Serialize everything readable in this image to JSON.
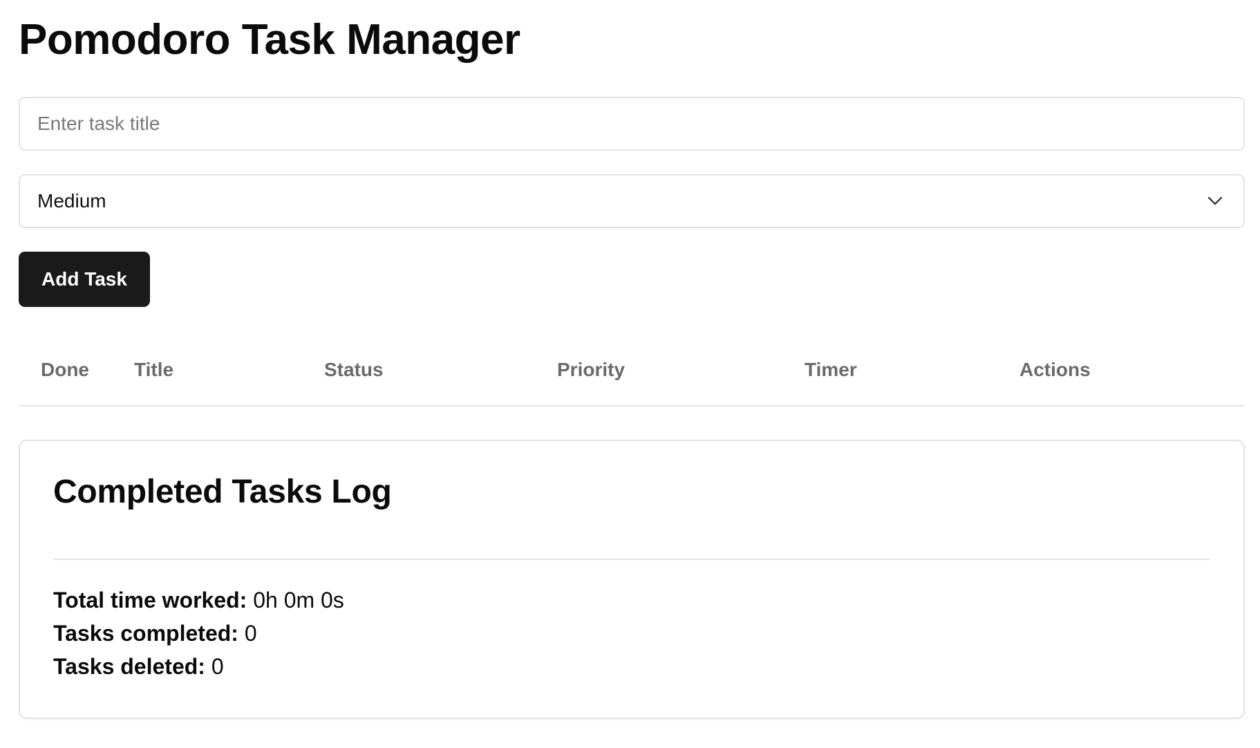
{
  "header": {
    "title": "Pomodoro Task Manager"
  },
  "form": {
    "title_placeholder": "Enter task title",
    "title_value": "",
    "priority_selected": "Medium",
    "add_button_label": "Add Task"
  },
  "table": {
    "columns": [
      "Done",
      "Title",
      "Status",
      "Priority",
      "Timer",
      "Actions"
    ],
    "rows": []
  },
  "log": {
    "title": "Completed Tasks Log",
    "stats": [
      {
        "label": "Total time worked:",
        "value": "0h 0m 0s"
      },
      {
        "label": "Tasks completed:",
        "value": "0"
      },
      {
        "label": "Tasks deleted:",
        "value": "0"
      }
    ]
  },
  "colors": {
    "primary_button": "#1a1a1b",
    "border": "#e3e3e3",
    "header_text": "#6a6a6a"
  },
  "icons": {
    "select_indicator": "chevron-down-icon"
  }
}
